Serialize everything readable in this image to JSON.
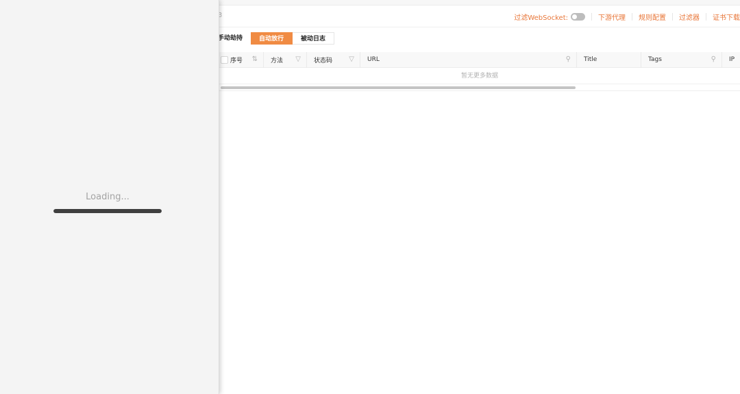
{
  "loading": {
    "text": "Loading...",
    "progress": 1.0
  },
  "header": {
    "counter": "3",
    "filter_websocket_label": "过滤WebSocket:",
    "filter_websocket_on": false,
    "links": [
      "下游代理",
      "规则配置",
      "过滤器",
      "证书下载"
    ]
  },
  "tabs": [
    {
      "label": "手动劫持",
      "active": false
    },
    {
      "label": "自动放行",
      "active": true
    },
    {
      "label": "被动日志",
      "active": false
    }
  ],
  "table": {
    "columns": [
      "序号",
      "方法",
      "状态码",
      "URL",
      "Title",
      "Tags",
      "IP"
    ],
    "empty_text": "暂无更多数据"
  },
  "colors": {
    "accent": "#f08b43",
    "link": "#e8773a"
  }
}
